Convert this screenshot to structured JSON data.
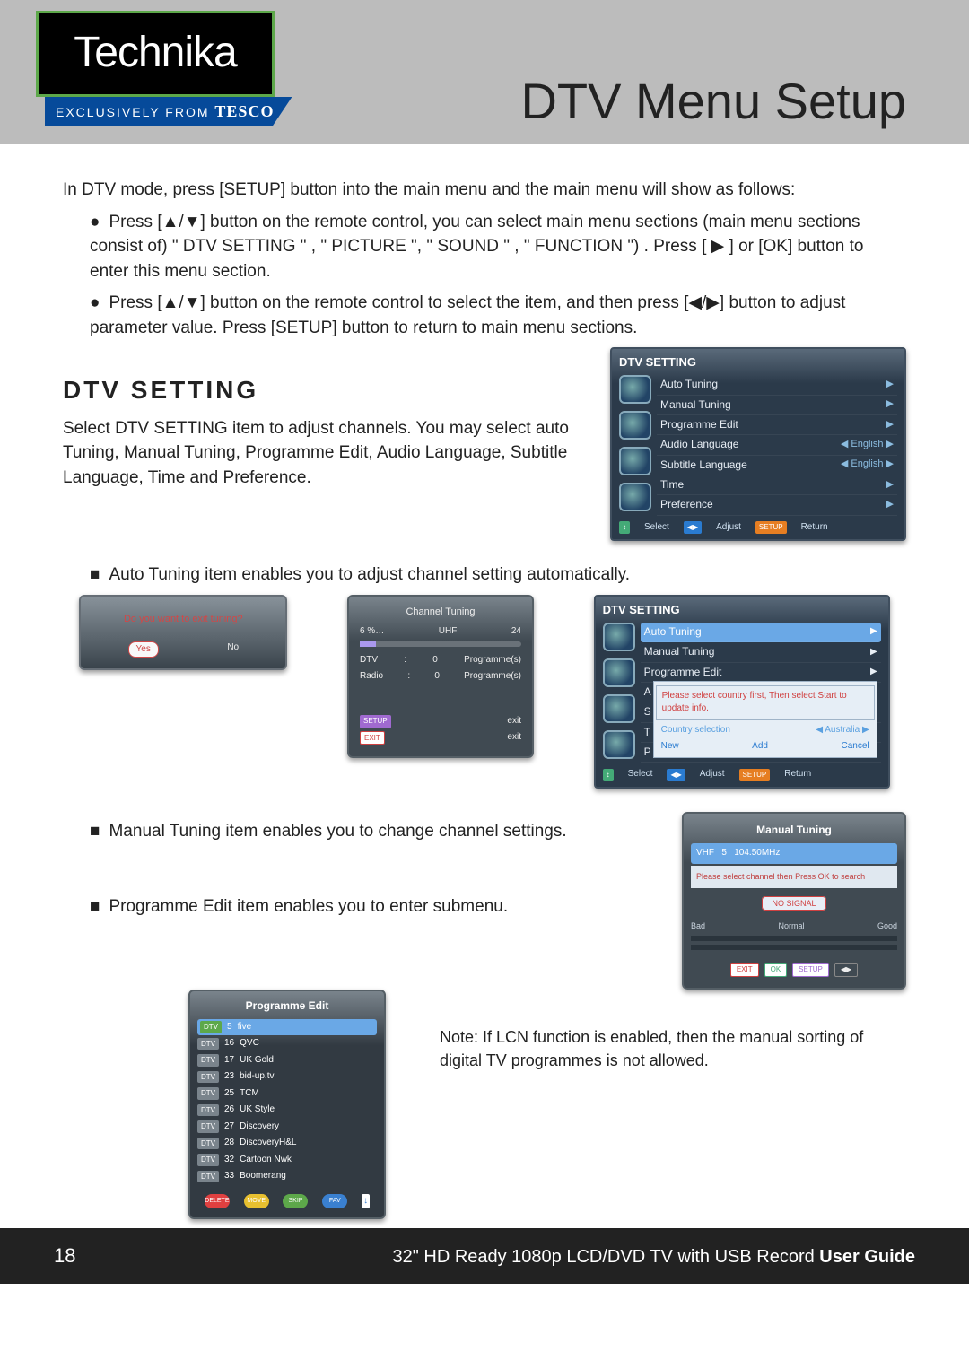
{
  "header": {
    "brand": "Technika",
    "ribbon_prefix": "EXCLUSIVELY FROM",
    "ribbon_brand": "TESCO",
    "page_title": "DTV Menu Setup"
  },
  "intro": "In DTV mode, press [SETUP] button into the main menu and the main menu will show as follows:",
  "bullets": [
    "Press [▲/▼] button on the remote control, you can select main menu sections (main menu sections consist of) \" DTV SETTING \" , \" PICTURE \", \" SOUND \" , \" FUNCTION \") . Press [ ▶ ] or [OK] button to enter  this menu section.",
    "Press [▲/▼] button on the remote control to select the item, and then press [◀/▶] button to adjust parameter value. Press [SETUP] button to return to main menu sections."
  ],
  "dtv_setting": {
    "heading": "DTV SETTING",
    "paragraph": "Select  DTV SETTING item to adjust channels. You may select  auto Tuning, Manual Tuning, Programme Edit, Audio Language, Subtitle Language, Time and Preference."
  },
  "osd1": {
    "title": "DTV SETTING",
    "items": [
      {
        "label": "Auto Tuning",
        "value": "",
        "arrow": "▶"
      },
      {
        "label": "Manual Tuning",
        "value": "",
        "arrow": "▶"
      },
      {
        "label": "Programme Edit",
        "value": "",
        "arrow": "▶"
      },
      {
        "label": "Audio Language",
        "value": "English",
        "arrow": "◀ ▶"
      },
      {
        "label": "Subtitle Language",
        "value": "English",
        "arrow": "◀ ▶"
      },
      {
        "label": "Time",
        "value": "",
        "arrow": "▶"
      },
      {
        "label": "Preference",
        "value": "",
        "arrow": "▶"
      }
    ],
    "bottom": {
      "select": "Select",
      "adjust": "Adjust",
      "return": "Return",
      "setup": "SETUP"
    }
  },
  "auto_tuning_text": "Auto Tuning item enables you to adjust channel setting automatically.",
  "channel_tuning": {
    "title": "Channel Tuning",
    "progress": "6  %…",
    "band": "UHF",
    "ch": "24",
    "dtv": "DTV",
    "dtv_n": "0",
    "dtv_unit": "Programme(s)",
    "radio": "Radio",
    "radio_n": "0",
    "radio_unit": "Programme(s)",
    "setup": "SETUP",
    "exit1": "exit",
    "exitbtn": "EXIT",
    "exit2": "exit"
  },
  "exit_dialog": {
    "msg": "Do you want to exit tuning?",
    "yes": "Yes",
    "no": "No"
  },
  "osd2": {
    "title": "DTV SETTING",
    "auto": "Auto Tuning",
    "manual": "Manual Tuning",
    "pe": "Programme Edit",
    "a": "A",
    "s": "S",
    "t": "T",
    "p": "P",
    "popup_msg": "Please select country first, Then select Start to update info.",
    "country_sel": "Country selection",
    "country": "Australia",
    "new": "New",
    "add": "Add",
    "cancel": "Cancel",
    "bottom": {
      "select": "Select",
      "adjust": "Adjust",
      "return": "Return",
      "setup": "SETUP"
    }
  },
  "manual_text": "Manual Tuning item enables you to change channel settings.",
  "manual_tuning": {
    "title": "Manual Tuning",
    "band": "VHF",
    "ch": "5",
    "freq": "104.50MHz",
    "msg": "Please select channel then Press OK to search",
    "nosignal": "NO SIGNAL",
    "bad": "Bad",
    "normal": "Normal",
    "good": "Good",
    "exit": "EXIT",
    "ok": "OK",
    "setup": "SETUP"
  },
  "pe_text": "Programme Edit item enables you to enter submenu.",
  "prog_edit": {
    "title": "Programme Edit",
    "rows": [
      {
        "tag": "DTV",
        "sel": true,
        "n": "5",
        "name": "five"
      },
      {
        "tag": "DTV",
        "n": "16",
        "name": "QVC"
      },
      {
        "tag": "DTV",
        "n": "17",
        "name": "UK Gold"
      },
      {
        "tag": "DTV",
        "n": "23",
        "name": "bid-up.tv"
      },
      {
        "tag": "DTV",
        "n": "25",
        "name": "TCM"
      },
      {
        "tag": "DTV",
        "n": "26",
        "name": "UK Style"
      },
      {
        "tag": "DTV",
        "n": "27",
        "name": "Discovery"
      },
      {
        "tag": "DTV",
        "n": "28",
        "name": "DiscoveryH&L"
      },
      {
        "tag": "DTV",
        "n": "32",
        "name": "Cartoon Nwk"
      },
      {
        "tag": "DTV",
        "n": "33",
        "name": "Boomerang"
      }
    ],
    "btns": {
      "del": "DELETE",
      "move": "MOVE",
      "skip": "SKIP",
      "fav": "FAV"
    }
  },
  "note": "Note: If LCN function is enabled, then the manual sorting of digital TV programmes is not allowed.",
  "footer": {
    "page": "18",
    "text_prefix": "32\" HD Ready 1080p LCD/DVD TV with USB Record ",
    "text_bold": "User Guide"
  }
}
